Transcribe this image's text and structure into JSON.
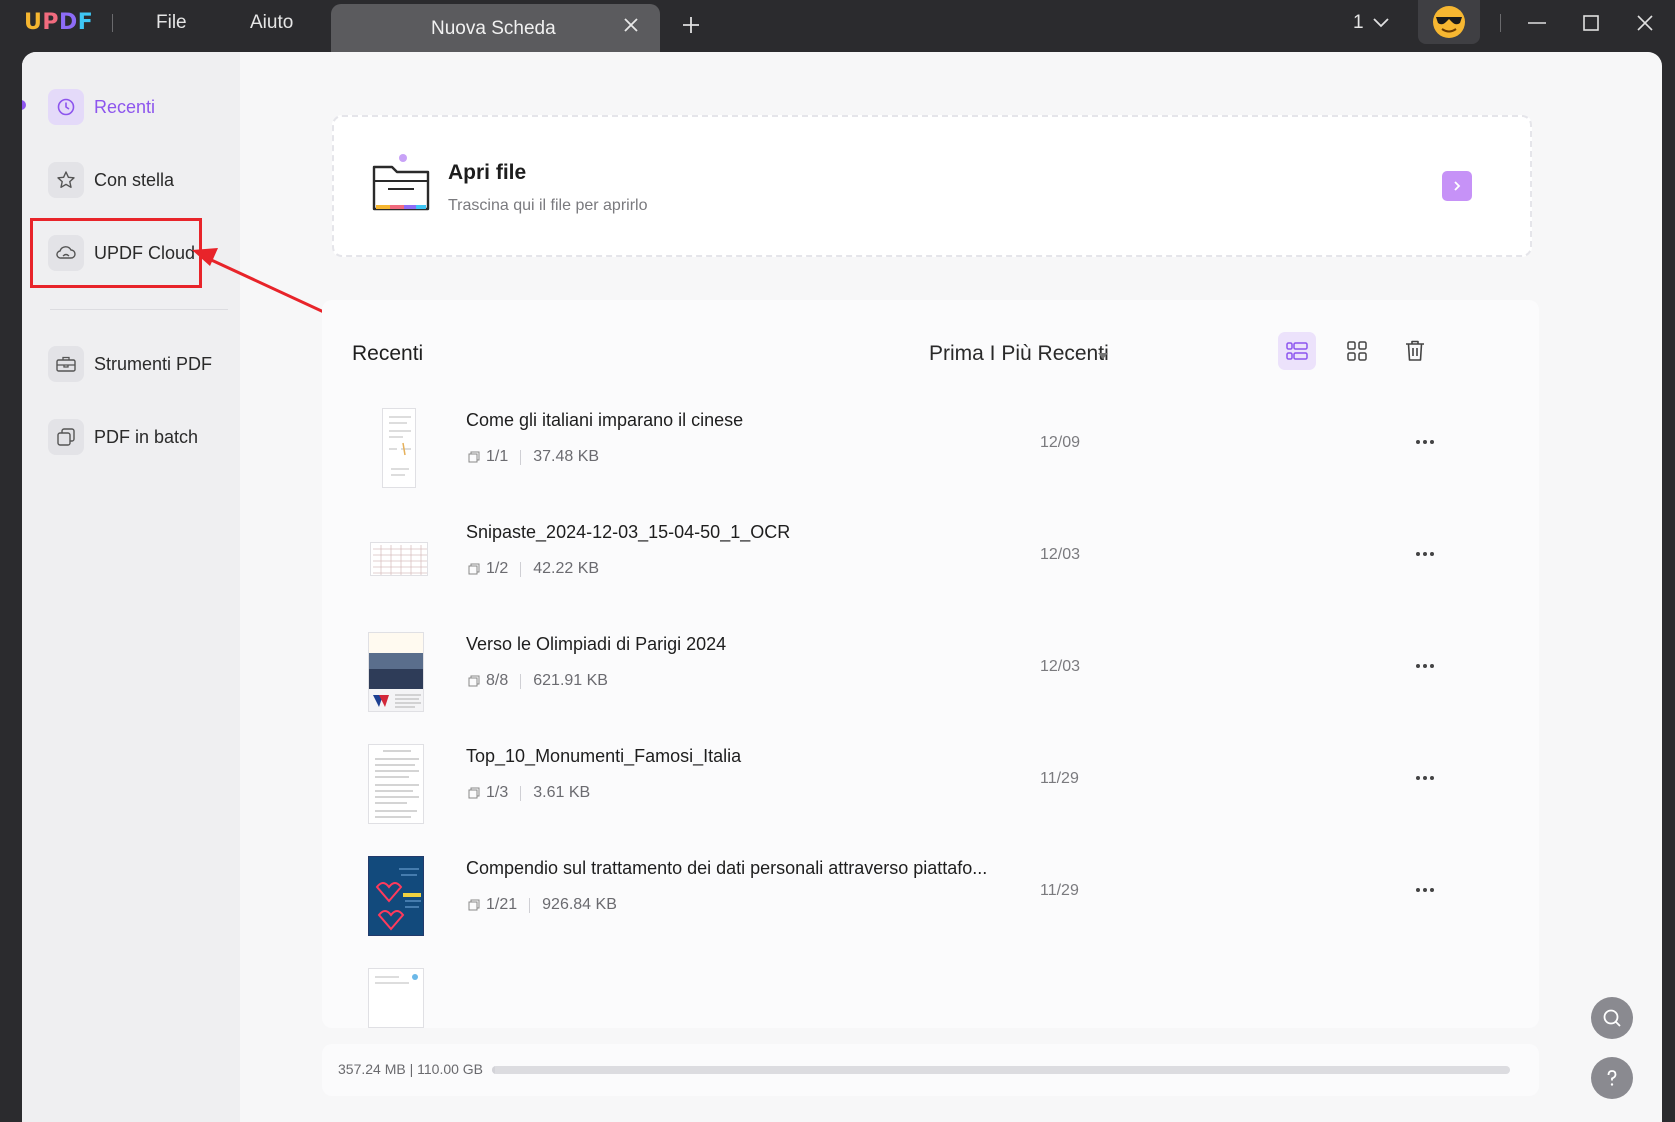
{
  "app": {
    "logo": "UPDF"
  },
  "menu": {
    "file": "File",
    "help": "Aiuto"
  },
  "tab": {
    "title": "Nuova Scheda"
  },
  "titlebar": {
    "page_indicator": "1"
  },
  "sidebar": {
    "items": [
      {
        "label": "Recenti",
        "icon": "clock-icon",
        "active": true
      },
      {
        "label": "Con stella",
        "icon": "star-icon"
      },
      {
        "label": "UPDF Cloud",
        "icon": "cloud-icon"
      },
      {
        "label": "Strumenti PDF",
        "icon": "toolbox-icon"
      },
      {
        "label": "PDF in batch",
        "icon": "batch-icon"
      }
    ]
  },
  "open_file": {
    "title": "Apri file",
    "subtitle": "Trascina qui il file per aprirlo"
  },
  "recent": {
    "title": "Recenti",
    "sort_label": "Prima I Più Recenti",
    "files": [
      {
        "name": "Come gli italiani imparano il cinese",
        "pages": "1/1",
        "size": "37.48 KB",
        "date": "12/09"
      },
      {
        "name": "Snipaste_2024-12-03_15-04-50_1_OCR",
        "pages": "1/2",
        "size": "42.22 KB",
        "date": "12/03"
      },
      {
        "name": "Verso le Olimpiadi di Parigi 2024",
        "pages": "8/8",
        "size": "621.91 KB",
        "date": "12/03"
      },
      {
        "name": "Top_10_Monumenti_Famosi_Italia",
        "pages": "1/3",
        "size": "3.61 KB",
        "date": "11/29"
      },
      {
        "name": "Compendio sul trattamento dei dati personali attraverso piattafo...",
        "pages": "1/21",
        "size": "926.84 KB",
        "date": "11/29"
      }
    ]
  },
  "storage": {
    "text": "357.24 MB | 110.00 GB",
    "used_fraction": 0.0032
  },
  "colors": {
    "accent": "#8d55ee",
    "highlight": "#e8242a"
  }
}
